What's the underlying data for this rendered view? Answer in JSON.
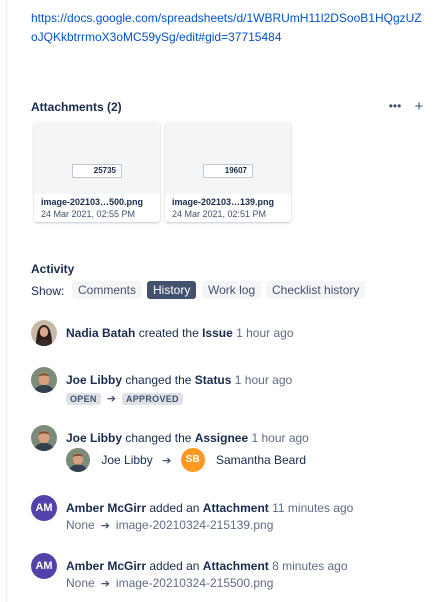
{
  "link": {
    "text": "https://docs.google.com/spreadsheets/d/1WBRUmH11l2DSooB1HQgzUZoJQKkbtrrmoX3oMC59ySg/edit#gid=37715484"
  },
  "attachments": {
    "title": "Attachments (2)",
    "more_icon": "more-icon",
    "add_icon": "add-icon",
    "items": [
      {
        "thumb_text": "25735",
        "name": "image-202103…500.png",
        "date": "24 Mar 2021, 02:55 PM"
      },
      {
        "thumb_text": "19607",
        "name": "image-202103…139.png",
        "date": "24 Mar 2021, 02:51 PM"
      }
    ]
  },
  "activity": {
    "title": "Activity",
    "show_label": "Show:",
    "tabs": [
      {
        "label": "Comments",
        "active": false
      },
      {
        "label": "History",
        "active": true
      },
      {
        "label": "Work log",
        "active": false
      },
      {
        "label": "Checklist history",
        "active": false
      }
    ],
    "items": [
      {
        "user": "Nadia Batah",
        "action": "created the",
        "field": "Issue",
        "time": "1 hour ago"
      },
      {
        "user": "Joe Libby",
        "action": "changed the",
        "field": "Status",
        "time": "1 hour ago",
        "from": "OPEN",
        "to": "APPROVED"
      },
      {
        "user": "Joe Libby",
        "action": "changed the",
        "field": "Assignee",
        "time": "1 hour ago",
        "from": "Joe Libby",
        "to": "Samantha Beard",
        "to_initials": "SB"
      },
      {
        "user": "Amber McGirr",
        "initials": "AM",
        "action": "added an",
        "field": "Attachment",
        "time": "11 minutes ago",
        "from": "None",
        "to": "image-20210324-215139.png"
      },
      {
        "user": "Amber McGirr",
        "initials": "AM",
        "action": "added an",
        "field": "Attachment",
        "time": "8 minutes ago",
        "from": "None",
        "to": "image-20210324-215500.png"
      }
    ]
  },
  "colors": {
    "link": "#0052cc",
    "active_tab": "#42526e",
    "amber_avatar": "#5243aa",
    "sb_avatar": "#ff991f"
  }
}
